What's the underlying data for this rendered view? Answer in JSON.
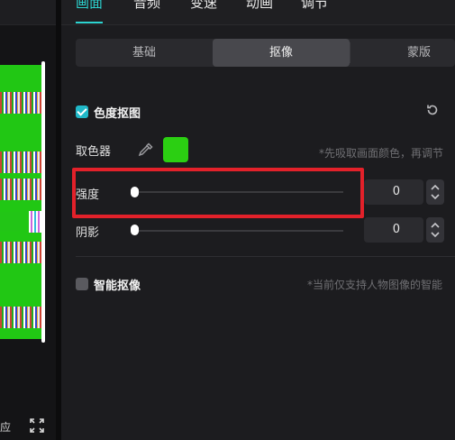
{
  "preview": {
    "bottom_label": "应"
  },
  "main_tabs": [
    {
      "label": "画面"
    },
    {
      "label": "音频"
    },
    {
      "label": "变速"
    },
    {
      "label": "动画"
    },
    {
      "label": "调节"
    }
  ],
  "segments": [
    {
      "label": "基础"
    },
    {
      "label": "抠像"
    },
    {
      "label": "蒙版"
    }
  ],
  "chroma_key": {
    "label": "色度抠图",
    "checked": true,
    "color_picker_label": "取色器",
    "picker_hint": "*先吸取画面颜色，再调节",
    "picked_color": "#2bcf12"
  },
  "sliders": [
    {
      "label": "强度",
      "value": "0",
      "level": 0
    },
    {
      "label": "阴影",
      "value": "0",
      "level": 0
    }
  ],
  "smart_keying": {
    "label": "智能抠像",
    "checked": false,
    "hint": "*当前仅支持人物图像的智能"
  },
  "colors": {
    "accent": "#2cd3d0",
    "highlight": "#e3212a",
    "checkbox_on": "#20b8c8"
  }
}
